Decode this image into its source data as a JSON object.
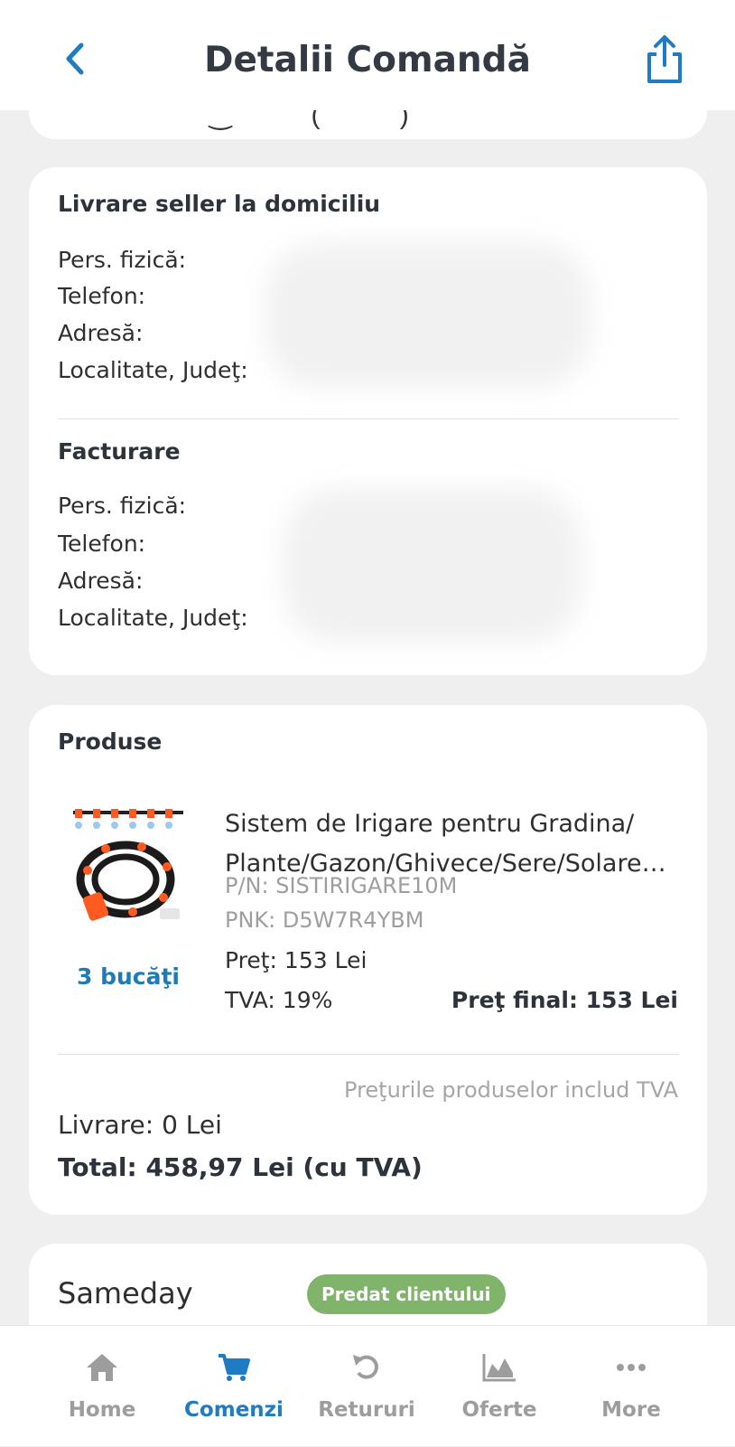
{
  "header": {
    "title": "Detalii Comandă",
    "back_icon": "chevron-left-icon",
    "share_icon": "share-icon",
    "accent_color": "#1e7bc4"
  },
  "delivery": {
    "title": "Livrare seller la domiciliu",
    "labels": [
      "Pers. fizică:",
      "Telefon:",
      "Adresă:",
      "Localitate, Judeţ:"
    ]
  },
  "billing": {
    "title": "Facturare",
    "labels": [
      "Pers. fizică:",
      "Telefon:",
      "Adresă:",
      "Localitate, Judeţ:"
    ]
  },
  "products": {
    "title": "Produse",
    "item": {
      "name_line1": "Sistem de Irigare pentru Gradina/",
      "name_line2": "Plante/Gazon/Ghivece/Sere/Solare…",
      "pn": "P/N: SISTIRIGARE10M",
      "pnk": "PNK: D5W7R4YBM",
      "quantity": "3 bucăţi",
      "price": "Preţ: 153 Lei",
      "vat": "TVA: 19%",
      "final_price": "Preţ final: 153 Lei"
    },
    "vat_note": "Preţurile produselor includ TVA",
    "shipping": "Livrare: 0 Lei",
    "total": "Total: 458,97 Lei (cu TVA)"
  },
  "courier": {
    "name": "Sameday",
    "status": "Predat clientului",
    "status_color": "#7fb46a"
  },
  "tabbar": {
    "items": [
      {
        "label": "Home",
        "icon": "home-icon",
        "active": false
      },
      {
        "label": "Comenzi",
        "icon": "cart-icon",
        "active": true
      },
      {
        "label": "Retururi",
        "icon": "return-icon",
        "active": false
      },
      {
        "label": "Oferte",
        "icon": "area-chart-icon",
        "active": false
      },
      {
        "label": "More",
        "icon": "more-icon",
        "active": false
      }
    ]
  }
}
